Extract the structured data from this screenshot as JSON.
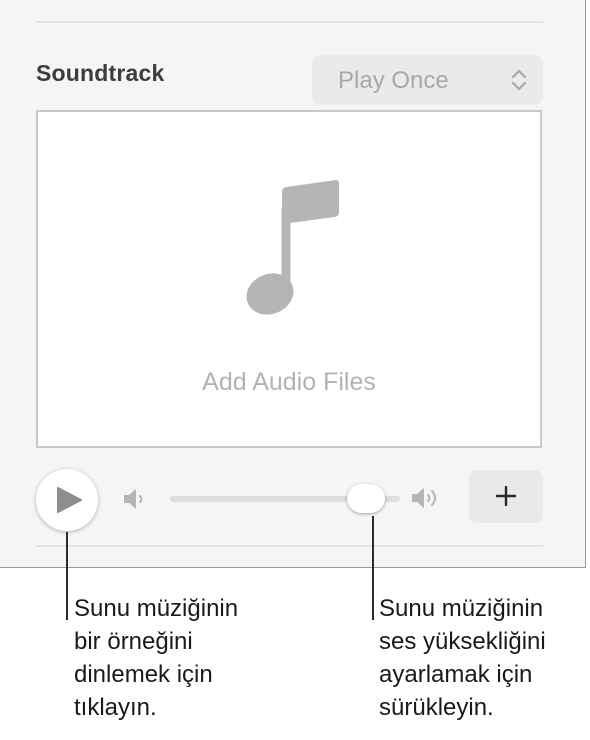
{
  "soundtrack": {
    "title": "Soundtrack",
    "playback_mode": "Play Once",
    "drop_label": "Add Audio Files",
    "volume_level": 0.85
  },
  "icons": {
    "popup": "chevron-up-down-icon",
    "drop": "music-note-icon",
    "play": "play-icon",
    "vol_low": "speaker-low-icon",
    "vol_high": "speaker-high-icon",
    "add": "plus-icon"
  },
  "colors": {
    "panel_bg": "#f5f5f4",
    "icon_gray": "#b5b5b5",
    "play_gray": "#8e8e8e"
  },
  "callouts": {
    "play": [
      "Sunu müziğinin",
      "bir örneğini",
      "dinlemek için",
      "tıklayın."
    ],
    "volume": [
      "Sunu müziğinin",
      "ses yüksekliğini",
      "ayarlamak için",
      "sürükleyin."
    ]
  }
}
